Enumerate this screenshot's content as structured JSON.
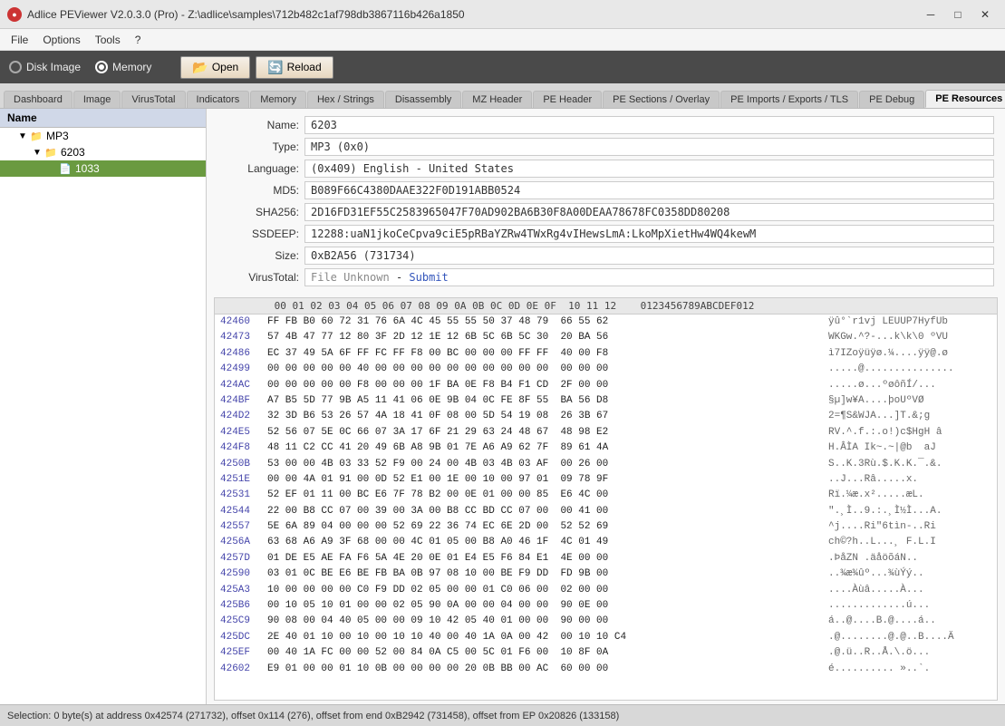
{
  "app": {
    "title": "Adlice PEViewer V2.0.3.0 (Pro) - Z:\\adlice\\samples\\712b482c1af798db3867116b426a1850",
    "icon": "●"
  },
  "titlebar": {
    "minimize": "─",
    "maximize": "□",
    "close": "✕"
  },
  "menu": {
    "items": [
      "File",
      "Options",
      "Tools",
      "?"
    ]
  },
  "toolbar": {
    "disk_label": "Disk Image",
    "memory_label": "Memory",
    "open_label": "Open",
    "reload_label": "Reload",
    "open_icon": "📂",
    "reload_icon": "🔄"
  },
  "tabs": [
    "Dashboard",
    "Image",
    "VirusTotal",
    "Indicators",
    "Memory",
    "Hex / Strings",
    "Disassembly",
    "MZ Header",
    "PE Header",
    "PE Sections / Overlay",
    "PE Imports / Exports / TLS",
    "PE Debug",
    "PE Resources",
    "Version"
  ],
  "active_tab": "PE Resources",
  "tree": {
    "header": "Name",
    "items": [
      {
        "id": "mp3",
        "label": "MP3",
        "level": 1,
        "type": "folder",
        "expanded": true
      },
      {
        "id": "6203",
        "label": "6203",
        "level": 2,
        "type": "folder",
        "expanded": true
      },
      {
        "id": "1033",
        "label": "1033",
        "level": 3,
        "type": "file",
        "selected": true
      }
    ]
  },
  "details": {
    "name_label": "Name:",
    "name_value": "6203",
    "type_label": "Type:",
    "type_value": "MP3 (0x0)",
    "language_label": "Language:",
    "language_value": "(0x409) English - United States",
    "md5_label": "MD5:",
    "md5_value": "B089F66C4380DAAE322F0D191ABB0524",
    "sha256_label": "SHA256:",
    "sha256_value": "2D16FD31EF55C2583965047F70AD902BA6B30F8A00DEAA78678FC0358DD80208",
    "ssdeep_label": "SSDEEP:",
    "ssdeep_value": "12288:uaN1jkoCeCpva9ciE5pRBaYZRw4TWxRg4vIHewsLmA:LkoMpXietHw4WQ4kewM",
    "size_label": "Size:",
    "size_value": "0xB2A56 (731734)",
    "virustotal_label": "VirusTotal:",
    "virustotal_value": "File Unknown",
    "virustotal_link": "Submit"
  },
  "hex": {
    "header": "         00 01 02 03 04 05 06 07 08 09 0A 0B 0C 0D 0E 0F  10 11 12    0123456789ABCDEF012",
    "rows": [
      {
        "addr": "42460",
        "bytes": "FF FB B0 60 72 31 76 6A 4C 45 55 55 50 37 48 79  66 55 62",
        "ascii": "ÿû°`r1vj LEUUP7HyfUb"
      },
      {
        "addr": "42473",
        "bytes": "57 4B 47 77 12 80 3F 2D 12 1E 12 6B 5C 6B 5C 30  20 BA 56",
        "ascii": "WKGw.^?-...k\\k\\0 ºVU"
      },
      {
        "addr": "42486",
        "bytes": "EC 37 49 5A 6F FF FC FF F8 00 BC 00 00 00 FF FF  40 00 F8",
        "ascii": "ì7IZoÿüÿø.¼....ÿÿ@.ø"
      },
      {
        "addr": "42499",
        "bytes": "00 00 00 00 00 40 00 00 00 00 00 00 00 00 00 00  00 00 00",
        "ascii": ".....@..............."
      },
      {
        "addr": "424AC",
        "bytes": "00 00 00 00 00 F8 00 00 00 1F BA 0E F8 B4 F1 CD  2F 00 00",
        "ascii": ".....ø...ºøôñÍ/..."
      },
      {
        "addr": "424BF",
        "bytes": "A7 B5 5D 77 9B A5 11 41 06 0E 9B 04 0C FE 8F 55  BA 56 D8",
        "ascii": "§µ]w¥A....þoUºVØ"
      },
      {
        "addr": "424D2",
        "bytes": "32 3D B6 53 26 57 4A 18 41 0F 08 00 5D 54 19 08  26 3B 67",
        "ascii": "2=¶S&WJA...]T.&;g"
      },
      {
        "addr": "424E5",
        "bytes": "52 56 07 5E 0C 66 07 3A 17 6F 21 29 63 24 48 67  48 98 E2",
        "ascii": "RV.^.f.:.o!)c$HgH â"
      },
      {
        "addr": "424F8",
        "bytes": "48 11 C2 CC 41 20 49 6B A8 9B 01 7E A6 A9 62 7F  89 61 4A",
        "ascii": "H.ÂÌA Ik~.~|@b  aJ"
      },
      {
        "addr": "4250B",
        "bytes": "53 00 00 4B 03 33 52 F9 00 24 00 4B 03 4B 03 AF  00 26 00",
        "ascii": "S..K.3Rù.$.K.K.¯.&."
      },
      {
        "addr": "4251E",
        "bytes": "00 00 4A 01 91 00 0D 52 E1 00 1E 00 10 00 97 01  09 78 9F",
        "ascii": "..J...Râ.....x."
      },
      {
        "addr": "42531",
        "bytes": "52 EF 01 11 00 BC E6 7F 78 B2 00 0E 01 00 00 85  E6 4C 00",
        "ascii": "Rï.¼æ.x².....æL."
      },
      {
        "addr": "42544",
        "bytes": "22 00 B8 CC 07 00 39 00 3A 00 B8 CC BD CC 07 00  00 41 00",
        "ascii": "\".¸Ì..9.:.¸Ì½Ì...A."
      },
      {
        "addr": "42557",
        "bytes": "5E 6A 89 04 00 00 00 52 69 22 36 74 EC 6E 2D 00  52 52 69",
        "ascii": "^j....Ri\"6tìn-..Ri"
      },
      {
        "addr": "4256A",
        "bytes": "63 68 A6 A9 3F 68 00 00 4C 01 05 00 B8 A0 46 1F  4C 01 49",
        "ascii": "ch©?h..L...¸ F.L.I"
      },
      {
        "addr": "4257D",
        "bytes": "01 DE E5 AE FA F6 5A 4E 20 0E 01 E4 E5 F6 84 E1  4E 00 00",
        "ascii": ".ÞåZN .äåöõáN.."
      },
      {
        "addr": "42590",
        "bytes": "03 01 0C BE E6 BE FB BA 0B 97 08 10 00 BE F9 DD  FD 9B 00",
        "ascii": "..¾æ¾ûº...¾ùÝý.."
      },
      {
        "addr": "425A3",
        "bytes": "10 00 00 00 00 C0 F9 DD 02 05 00 00 01 C0 06 00  02 00 00",
        "ascii": "....Àùâ.....À..."
      },
      {
        "addr": "425B6",
        "bytes": "00 10 05 10 01 00 00 02 05 90 0A 00 00 04 00 00  90 0E 00",
        "ascii": ".............ú..."
      },
      {
        "addr": "425C9",
        "bytes": "90 08 00 04 40 05 00 00 09 10 42 05 40 01 00 00  90 00 00",
        "ascii": "á..@....B.@....á.."
      },
      {
        "addr": "425DC",
        "bytes": "2E 40 01 10 00 10 00 10 10 40 00 40 1A 0A 00 42  00 10 10 C4",
        "ascii": ".@........@.@..B....Ä"
      },
      {
        "addr": "425EF",
        "bytes": "00 40 1A FC 00 00 52 00 84 0A C5 00 5C 01 F6 00  10 8F 0A",
        "ascii": ".@.ü..R..Å.\\.ö..."
      },
      {
        "addr": "42602",
        "bytes": "E9 01 00 00 01 10 0B 00 00 00 00 20 0B BB 00 AC  60 00 00",
        "ascii": "é.......... »..`. "
      }
    ]
  },
  "statusbar": {
    "text": "Selection: 0 byte(s) at address 0x42574 (271732), offset 0x114 (276), offset from end 0xB2942 (731458), offset from EP 0x20826 (133158)"
  }
}
